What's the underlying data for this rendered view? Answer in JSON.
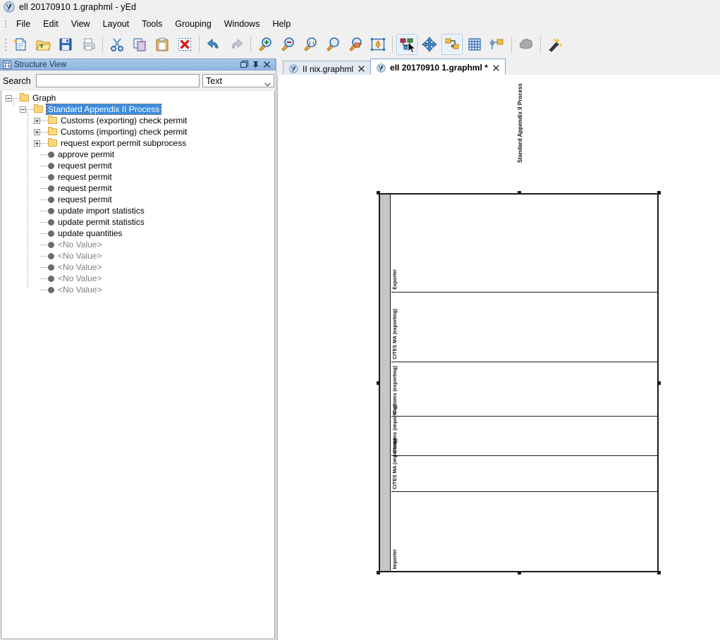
{
  "window": {
    "title": "ell 20170910 1.graphml - yEd",
    "app_icon": "yed-logo-icon"
  },
  "menubar": {
    "items": [
      "File",
      "Edit",
      "View",
      "Layout",
      "Tools",
      "Grouping",
      "Windows",
      "Help"
    ]
  },
  "toolbar": {
    "buttons": [
      {
        "name": "new-document-button",
        "icon": "new-document-icon",
        "pressed": false
      },
      {
        "name": "open-button",
        "icon": "open-folder-icon",
        "pressed": false
      },
      {
        "name": "save-button",
        "icon": "floppy-disk-icon",
        "pressed": false
      },
      {
        "name": "print-button",
        "icon": "printer-icon",
        "pressed": false
      },
      {
        "name": "separator",
        "icon": "separator",
        "pressed": false
      },
      {
        "name": "cut-button",
        "icon": "scissors-icon",
        "pressed": false
      },
      {
        "name": "copy-button",
        "icon": "copy-icon",
        "pressed": false
      },
      {
        "name": "paste-button",
        "icon": "clipboard-paste-icon",
        "pressed": false
      },
      {
        "name": "delete-button",
        "icon": "delete-x-icon",
        "pressed": false
      },
      {
        "name": "separator",
        "icon": "separator",
        "pressed": false
      },
      {
        "name": "undo-button",
        "icon": "undo-arrow-icon",
        "pressed": false
      },
      {
        "name": "redo-button",
        "icon": "redo-arrow-icon",
        "pressed": false
      },
      {
        "name": "separator",
        "icon": "separator",
        "pressed": false
      },
      {
        "name": "zoom-in-button",
        "icon": "magnifier-plus-icon",
        "pressed": false
      },
      {
        "name": "zoom-out-button",
        "icon": "magnifier-minus-icon",
        "pressed": false
      },
      {
        "name": "zoom-actual-size-button",
        "icon": "magnifier-one-to-one-icon",
        "pressed": false
      },
      {
        "name": "fit-content-button",
        "icon": "magnifier-icon",
        "pressed": false
      },
      {
        "name": "zoom-area-button",
        "icon": "magnifier-area-icon",
        "pressed": false
      },
      {
        "name": "fit-page-button",
        "icon": "fit-page-icon",
        "pressed": false
      },
      {
        "name": "separator",
        "icon": "separator",
        "pressed": false
      },
      {
        "name": "edit-mode-button",
        "icon": "select-nodes-icon",
        "pressed": true
      },
      {
        "name": "navigate-mode-button",
        "icon": "move-arrows-icon",
        "pressed": false
      },
      {
        "name": "create-edge-mode-button",
        "icon": "create-edge-icon",
        "pressed": true
      },
      {
        "name": "grid-button",
        "icon": "grid-icon",
        "pressed": false
      },
      {
        "name": "snapline-button",
        "icon": "snapline-icon",
        "pressed": false
      },
      {
        "name": "separator",
        "icon": "separator",
        "pressed": false
      },
      {
        "name": "fit-node-to-label-button",
        "icon": "cloud-shape-icon",
        "pressed": false
      },
      {
        "name": "separator",
        "icon": "separator",
        "pressed": false
      },
      {
        "name": "properties-button",
        "icon": "magic-wand-icon",
        "pressed": false
      }
    ],
    "cursor": "mouse-pointer"
  },
  "structure_view": {
    "title": "Structure View",
    "header_icon": "structure-view-icon",
    "window_buttons": [
      "float-icon",
      "pin-icon",
      "close-icon"
    ],
    "search": {
      "label": "Search",
      "value": "",
      "placeholder": ""
    },
    "filter": {
      "value": "Text",
      "options": [
        "Text"
      ]
    },
    "tree": [
      {
        "label": "Graph",
        "depth": 0,
        "type": "folder",
        "toggle": "minus",
        "selected": false
      },
      {
        "label": "Standard Appendix II Process",
        "depth": 1,
        "type": "folder",
        "toggle": "minus",
        "selected": true
      },
      {
        "label": "Customs (exporting) check permit",
        "depth": 2,
        "type": "folder",
        "toggle": "plus",
        "selected": false
      },
      {
        "label": "Customs (importing) check permit",
        "depth": 2,
        "type": "folder",
        "toggle": "plus",
        "selected": false
      },
      {
        "label": "request export permit subprocess",
        "depth": 2,
        "type": "folder",
        "toggle": "plus",
        "selected": false
      },
      {
        "label": "approve permit",
        "depth": 2,
        "type": "node",
        "toggle": "none",
        "selected": false
      },
      {
        "label": "request permit",
        "depth": 2,
        "type": "node",
        "toggle": "none",
        "selected": false
      },
      {
        "label": "request permit",
        "depth": 2,
        "type": "node",
        "toggle": "none",
        "selected": false
      },
      {
        "label": "request permit",
        "depth": 2,
        "type": "node",
        "toggle": "none",
        "selected": false
      },
      {
        "label": "request permit",
        "depth": 2,
        "type": "node",
        "toggle": "none",
        "selected": false
      },
      {
        "label": "update import statistics",
        "depth": 2,
        "type": "node",
        "toggle": "none",
        "selected": false
      },
      {
        "label": "update permit statistics",
        "depth": 2,
        "type": "node",
        "toggle": "none",
        "selected": false
      },
      {
        "label": "update quantities",
        "depth": 2,
        "type": "node",
        "toggle": "none",
        "selected": false
      },
      {
        "label": "<No Value>",
        "depth": 2,
        "type": "node",
        "toggle": "none",
        "selected": false,
        "muted": true
      },
      {
        "label": "<No Value>",
        "depth": 2,
        "type": "node",
        "toggle": "none",
        "selected": false,
        "muted": true
      },
      {
        "label": "<No Value>",
        "depth": 2,
        "type": "node",
        "toggle": "none",
        "selected": false,
        "muted": true
      },
      {
        "label": "<No Value>",
        "depth": 2,
        "type": "node",
        "toggle": "none",
        "selected": false,
        "muted": true
      },
      {
        "label": "<No Value>",
        "depth": 2,
        "type": "node",
        "toggle": "none",
        "selected": false,
        "muted": true
      }
    ]
  },
  "editor_tabs": [
    {
      "label": "II nix.graphml",
      "active": false,
      "modified": false,
      "icon": "yed-document-icon"
    },
    {
      "label": "eII 20170910 1.graphml *",
      "active": true,
      "modified": true,
      "icon": "yed-document-icon"
    }
  ],
  "canvas": {
    "pool": {
      "title": "Standard Appendix II Process",
      "selected": true,
      "lanes": [
        {
          "label": "Exporter",
          "height_pct": 26.0
        },
        {
          "label": "CITES MA (exporting)",
          "height_pct": 18.5
        },
        {
          "label": "Customs (exporting)",
          "height_pct": 14.5
        },
        {
          "label": "Customs (importing)",
          "height_pct": 10.4
        },
        {
          "label": "CITES MA (importing)",
          "height_pct": 9.7
        },
        {
          "label": "Importer",
          "height_pct": 20.9
        }
      ]
    }
  },
  "colors": {
    "accent": "#3c8ce0",
    "panel_header_start": "#a8c8e8",
    "panel_header_end": "#8fb4dc",
    "folder": "#fcd77f",
    "pool_header": "#c6c6c6",
    "chrome": "#f0f0f0"
  }
}
